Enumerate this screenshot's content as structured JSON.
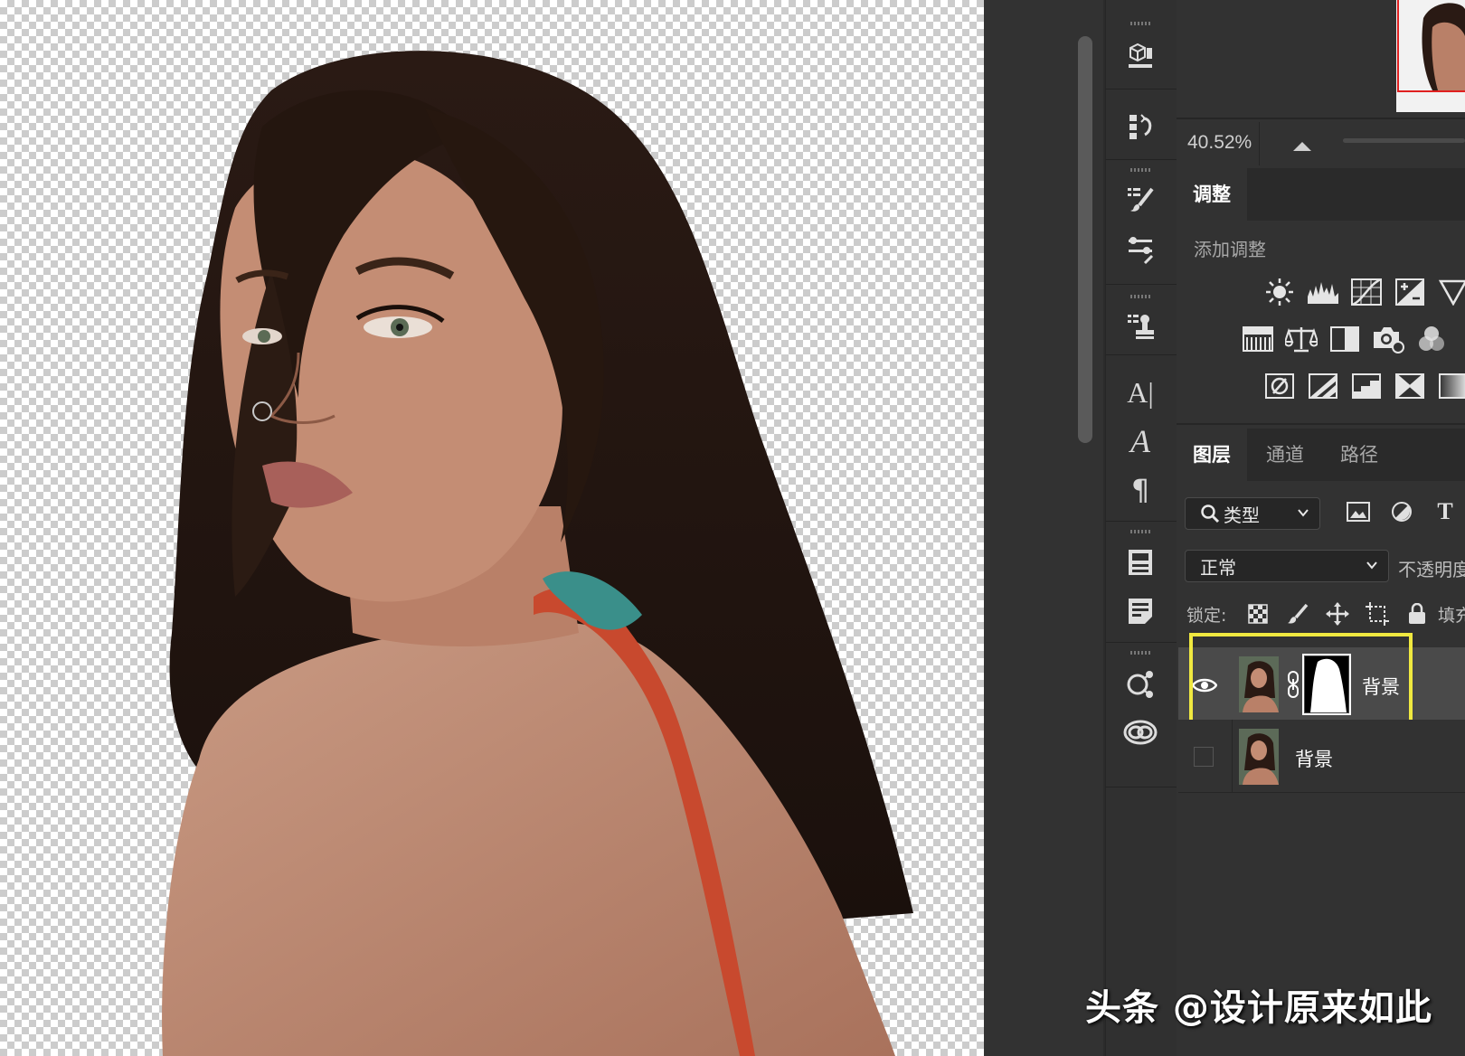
{
  "navigator": {
    "zoom": "40.52%"
  },
  "adjustments": {
    "tab_label": "调整",
    "add_label": "添加调整",
    "icons": [
      "brightness-contrast-icon",
      "levels-icon",
      "curves-icon",
      "exposure-icon",
      "vibrance-icon",
      "hue-saturation-icon",
      "color-balance-icon",
      "black-white-icon",
      "photo-filter-icon",
      "channel-mixer-icon",
      "invert-icon",
      "posterize-icon",
      "threshold-icon",
      "selective-color-icon",
      "gradient-map-icon"
    ]
  },
  "layers_panel": {
    "tabs": [
      "图层",
      "通道",
      "路径"
    ],
    "filter_label": "类型",
    "blend_mode": "正常",
    "opacity_label": "不透明度",
    "lock_label": "锁定:",
    "fill_label": "填充",
    "layers": [
      {
        "name": "背景",
        "visible": true,
        "has_mask": true,
        "selected": true
      },
      {
        "name": "背景",
        "visible": false,
        "has_mask": false,
        "selected": false
      }
    ]
  },
  "watermark": "头条 @设计原来如此",
  "colors": {
    "highlight": "#f0e940",
    "panel_bg": "#323232",
    "navigator_frame": "#e02020"
  }
}
